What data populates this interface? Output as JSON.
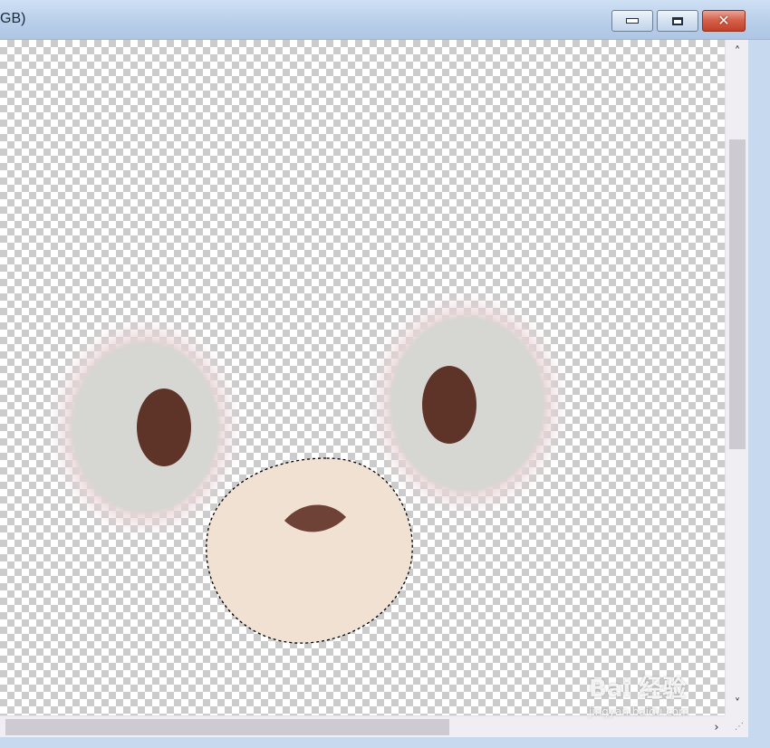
{
  "window": {
    "title": "GB)",
    "controls": {
      "minimize_icon": "minimize-icon",
      "maximize_icon": "restore-icon",
      "close_glyph": "✕"
    }
  },
  "canvas": {
    "background": "transparency-checkerboard",
    "colors": {
      "checker_light": "#ffffff",
      "checker_dark": "#cccccc",
      "eye_white": "#d6d6d2",
      "eye_glow": "#ead6d8",
      "pupil": "#5e3328",
      "muzzle": "#f1e1d2",
      "nose": "#6e4236",
      "selection_outline": "#000000"
    },
    "selection": "marching-ants selection around muzzle shape"
  },
  "scrollbars": {
    "up_arrow": "˄",
    "down_arrow": "˅",
    "right_arrow": "›",
    "grip": "⋰"
  },
  "watermark": {
    "brand": "Bai 经验",
    "url": "jingyan.baidu.com"
  }
}
